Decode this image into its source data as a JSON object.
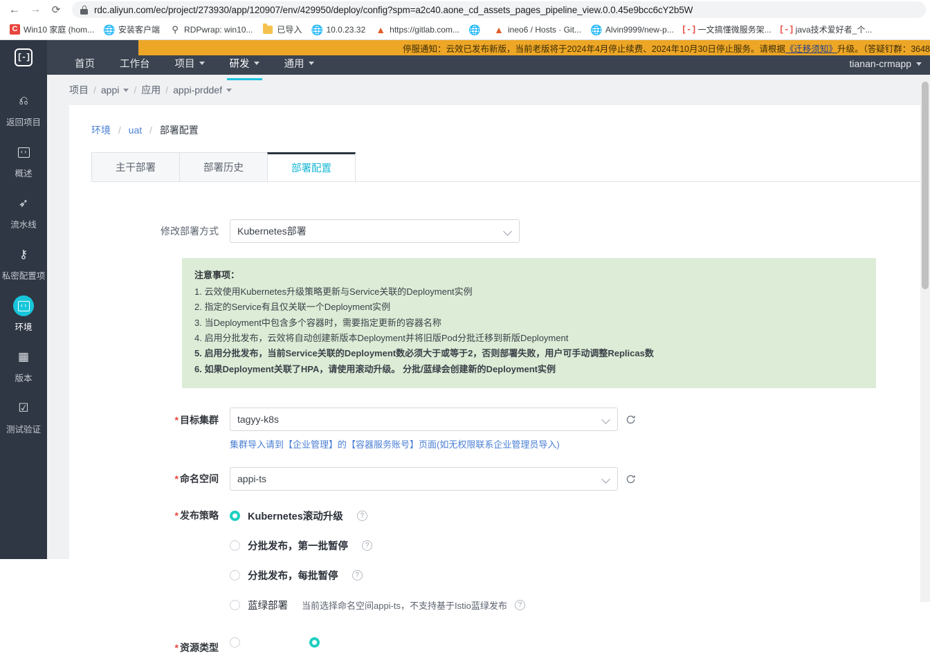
{
  "browser": {
    "back_icon": "back-arrow-icon",
    "forward_icon": "forward-arrow-icon",
    "reload_icon": "reload-icon",
    "url_host": "rdc.aliyun.com",
    "url_path": "/ec/project/273930/app/120907/env/429950/deploy/config?spm=a2c40.aone_cd_assets_pages_pipeline_view.0.0.45e9bcc6cY2b5W",
    "url_full": "rdc.aliyun.com/ec/project/273930/app/120907/env/429950/deploy/config?spm=a2c40.aone_cd_assets_pages_pipeline_view.0.0.45e9bcc6cY2b5W",
    "bookmarks": [
      {
        "label": "Win10 家庭 (hom...",
        "icon": "letter-c-icon"
      },
      {
        "label": "安装客户端",
        "icon": "globe-icon"
      },
      {
        "label": "RDPwrap: win10...",
        "icon": "rdp-icon"
      },
      {
        "label": "已导入",
        "icon": "folder-icon"
      },
      {
        "label": "10.0.23.32",
        "icon": "globe-icon"
      },
      {
        "label": "https://gitlab.com...",
        "icon": "gitlab-fox-icon"
      },
      {
        "label": "",
        "icon": "globe-icon"
      },
      {
        "label": "ineo6 / Hosts · Git...",
        "icon": "gitlab-fox-icon"
      },
      {
        "label": "Alvin9999/new-p...",
        "icon": "globe-icon"
      },
      {
        "label": "一文搞懂微服务架...",
        "icon": "bracket-icon"
      },
      {
        "label": "java技术爱好者_个...",
        "icon": "bracket-icon"
      }
    ]
  },
  "topbar": {
    "logo": "[-]",
    "nav": [
      {
        "label": "首页",
        "has_caret": false,
        "active": false
      },
      {
        "label": "工作台",
        "has_caret": false,
        "active": false
      },
      {
        "label": "项目",
        "has_caret": true,
        "active": false
      },
      {
        "label": "研发",
        "has_caret": true,
        "active": true
      },
      {
        "label": "通用",
        "has_caret": true,
        "active": false
      }
    ],
    "notice_prefix": "停服通知：云效已发布新版，当前老版将于2024年4月停止续费、2024年10月30日停止服务。请根据",
    "notice_link": "《迁移须知》",
    "notice_suffix": "升级。（答疑钉群：3648",
    "user": "tianan-crmapp"
  },
  "sidebar": {
    "items": [
      {
        "label": "返回项目",
        "icon": "back-circle-icon",
        "active": false
      },
      {
        "label": "概述",
        "icon": "overview-icon",
        "active": false
      },
      {
        "label": "流水线",
        "icon": "cursor-icon",
        "active": false
      },
      {
        "label": "私密配置项",
        "icon": "key-icon",
        "active": false
      },
      {
        "label": "环境",
        "icon": "environment-icon",
        "active": true
      },
      {
        "label": "版本",
        "icon": "version-icon",
        "active": false
      },
      {
        "label": "测试验证",
        "icon": "checklist-icon",
        "active": false
      }
    ]
  },
  "breadcrumb_top": {
    "items": [
      {
        "label": "项目",
        "caret": false
      },
      {
        "label": "appi",
        "caret": true
      },
      {
        "label": "应用",
        "caret": false
      },
      {
        "label": "appi-prddef",
        "caret": true
      }
    ],
    "separator": "/"
  },
  "breadcrumb_inner": {
    "items": [
      {
        "label": "环境",
        "link": true
      },
      {
        "label": "uat",
        "link": true
      },
      {
        "label": "部署配置",
        "link": false
      }
    ],
    "separator": "/"
  },
  "tabs": [
    {
      "label": "主干部署",
      "active": false
    },
    {
      "label": "部署历史",
      "active": false
    },
    {
      "label": "部署配置",
      "active": true
    }
  ],
  "form": {
    "deploy_mode": {
      "label": "修改部署方式",
      "value": "Kubernetes部署",
      "caret_icon": "chevron-down-icon"
    },
    "notice": {
      "title": "注意事项：",
      "items": [
        {
          "text": "1. 云效使用Kubernetes升级策略更新与Service关联的Deployment实例",
          "bold": false
        },
        {
          "text": "2. 指定的Service有且仅关联一个Deployment实例",
          "bold": false
        },
        {
          "text": "3. 当Deployment中包含多个容器时，需要指定更新的容器名称",
          "bold": false
        },
        {
          "text": "4. 启用分批发布，云效将自动创建新版本Deployment并将旧版Pod分批迁移到新版Deployment",
          "bold": false
        },
        {
          "text": "5. 启用分批发布，当前Service关联的Deployment数必须大于或等于2，否则部署失败，用户可手动调整Replicas数",
          "bold": true
        },
        {
          "text": "6. 如果Deployment关联了HPA，请使用滚动升级。 分批/蓝绿会创建新的Deployment实例",
          "bold": true
        }
      ]
    },
    "target_cluster": {
      "label": "目标集群",
      "required": true,
      "value": "tagyy-k8s",
      "refresh_icon": "refresh-icon",
      "helper": "集群导入请到【企业管理】的【容器服务账号】页面(如无权限联系企业管理员导入)"
    },
    "namespace": {
      "label": "命名空间",
      "required": true,
      "value": "appi-ts",
      "refresh_icon": "refresh-icon"
    },
    "release_strategy": {
      "label": "发布策略",
      "required": true,
      "options": [
        {
          "label": "Kubernetes滚动升级",
          "selected": true,
          "help": "?",
          "note": ""
        },
        {
          "label": "分批发布，第一批暂停",
          "selected": false,
          "help": "?",
          "note": ""
        },
        {
          "label": "分批发布，每批暂停",
          "selected": false,
          "help": "?",
          "note": ""
        },
        {
          "label": "蓝绿部署",
          "selected": false,
          "help": "?",
          "note": "当前选择命名空间appi-ts，不支持基于Istio蓝绿发布"
        }
      ]
    },
    "resource_type": {
      "label": "资源类型"
    }
  },
  "colors": {
    "accent_cyan": "#17b8d4",
    "accent_teal": "#1ecfc0",
    "notice_orange": "#eda626",
    "notice_green_bg": "#dcecd6",
    "nav_dark": "#3b4350",
    "rail_dark": "#2f3744",
    "link_blue": "#4a7fd4"
  }
}
